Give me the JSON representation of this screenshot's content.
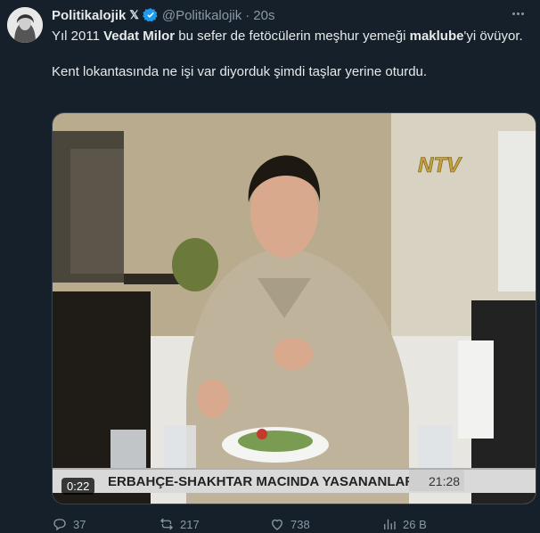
{
  "tweet": {
    "author_name": "Politikalojik",
    "badge": "𝕏",
    "handle": "@Politikalojik",
    "separator": "·",
    "time": "20s",
    "text": {
      "p1_a": "Yıl 2011 ",
      "p1_b": "Vedat Milor",
      "p1_c": " bu sefer de fetöcülerin meşhur yemeği ",
      "p1_d": "maklube",
      "p1_e": "'yi övüyor.",
      "p2": "Kent lokantasında ne işi var diyorduk şimdi taşlar yerine oturdu."
    }
  },
  "video": {
    "duration": "0:22",
    "channel_logo": "NTV",
    "ticker_text": "ERBAHÇE-SHAKHTAR  MACINDA  YASANANLARLA",
    "ticker_time": "21:28"
  },
  "actions": {
    "replies": "37",
    "reposts": "217",
    "likes": "738",
    "views": "26 B"
  },
  "colors": {
    "background": "#15202b",
    "text": "#e7e9ea",
    "muted": "#8b98a5",
    "verified": "#1d9bf0"
  }
}
